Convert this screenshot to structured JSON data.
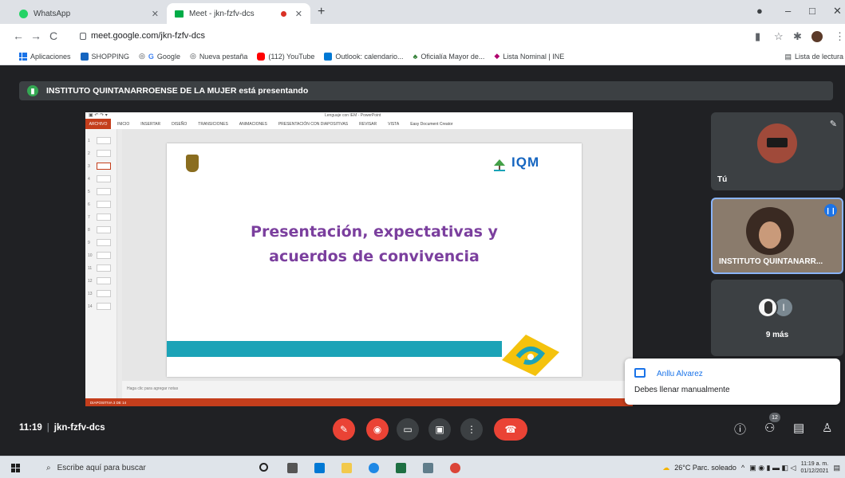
{
  "browser": {
    "tabs": [
      {
        "label": "WhatsApp",
        "favicon_color": "#25d366"
      },
      {
        "label": "Meet - jkn-fzfv-dcs",
        "favicon_color": "#00ac47",
        "active": true
      }
    ],
    "url": "meet.google.com/jkn-fzfv-dcs",
    "bookmarks": [
      "Aplicaciones",
      "SHOPPING",
      "Google",
      "Nueva pestaña",
      "(112) YouTube",
      "Outlook: calendario...",
      "Oficialía Mayor de...",
      "Lista Nominal | INE"
    ],
    "reading_list": "Lista de lectura"
  },
  "meet": {
    "banner": "INSTITUTO QUINTANARROENSE DE LA MUJER está presentando",
    "shared_screen": {
      "app_title": "Lenguaje con IEM - PowerPoint",
      "file_tab": "ARCHIVO",
      "ribbon_tabs": [
        "INICIO",
        "INSERTAR",
        "DISEÑO",
        "TRANSICIONES",
        "ANIMACIONES",
        "PRESENTACIÓN CON DIAPOSITIVAS",
        "REVISAR",
        "VISTA",
        "Easy Document Creator"
      ],
      "slide_title_line1": "Presentación, expectativas y",
      "slide_title_line2": "acuerdos de convivencia",
      "logo_text": "IQM",
      "notes_placeholder": "Haga clic para agregar notas",
      "status": "DIAPOSITIVA 3 DE 14"
    },
    "participants": [
      {
        "label": "Tú"
      },
      {
        "label": "INSTITUTO QUINTANARR..."
      },
      {
        "label": "9 más",
        "avatar_letter": "I"
      }
    ],
    "toast": {
      "name": "Anllu Alvarez",
      "message": "Debes llenar manualmente"
    },
    "time": "11:19",
    "meeting_code": "jkn-fzfv-dcs",
    "people_count": "12"
  },
  "taskbar": {
    "search_placeholder": "Escribe aquí para buscar",
    "weather": "26°C  Parc. soleado",
    "time": "11:19 a. m.",
    "date": "01/12/2021"
  }
}
